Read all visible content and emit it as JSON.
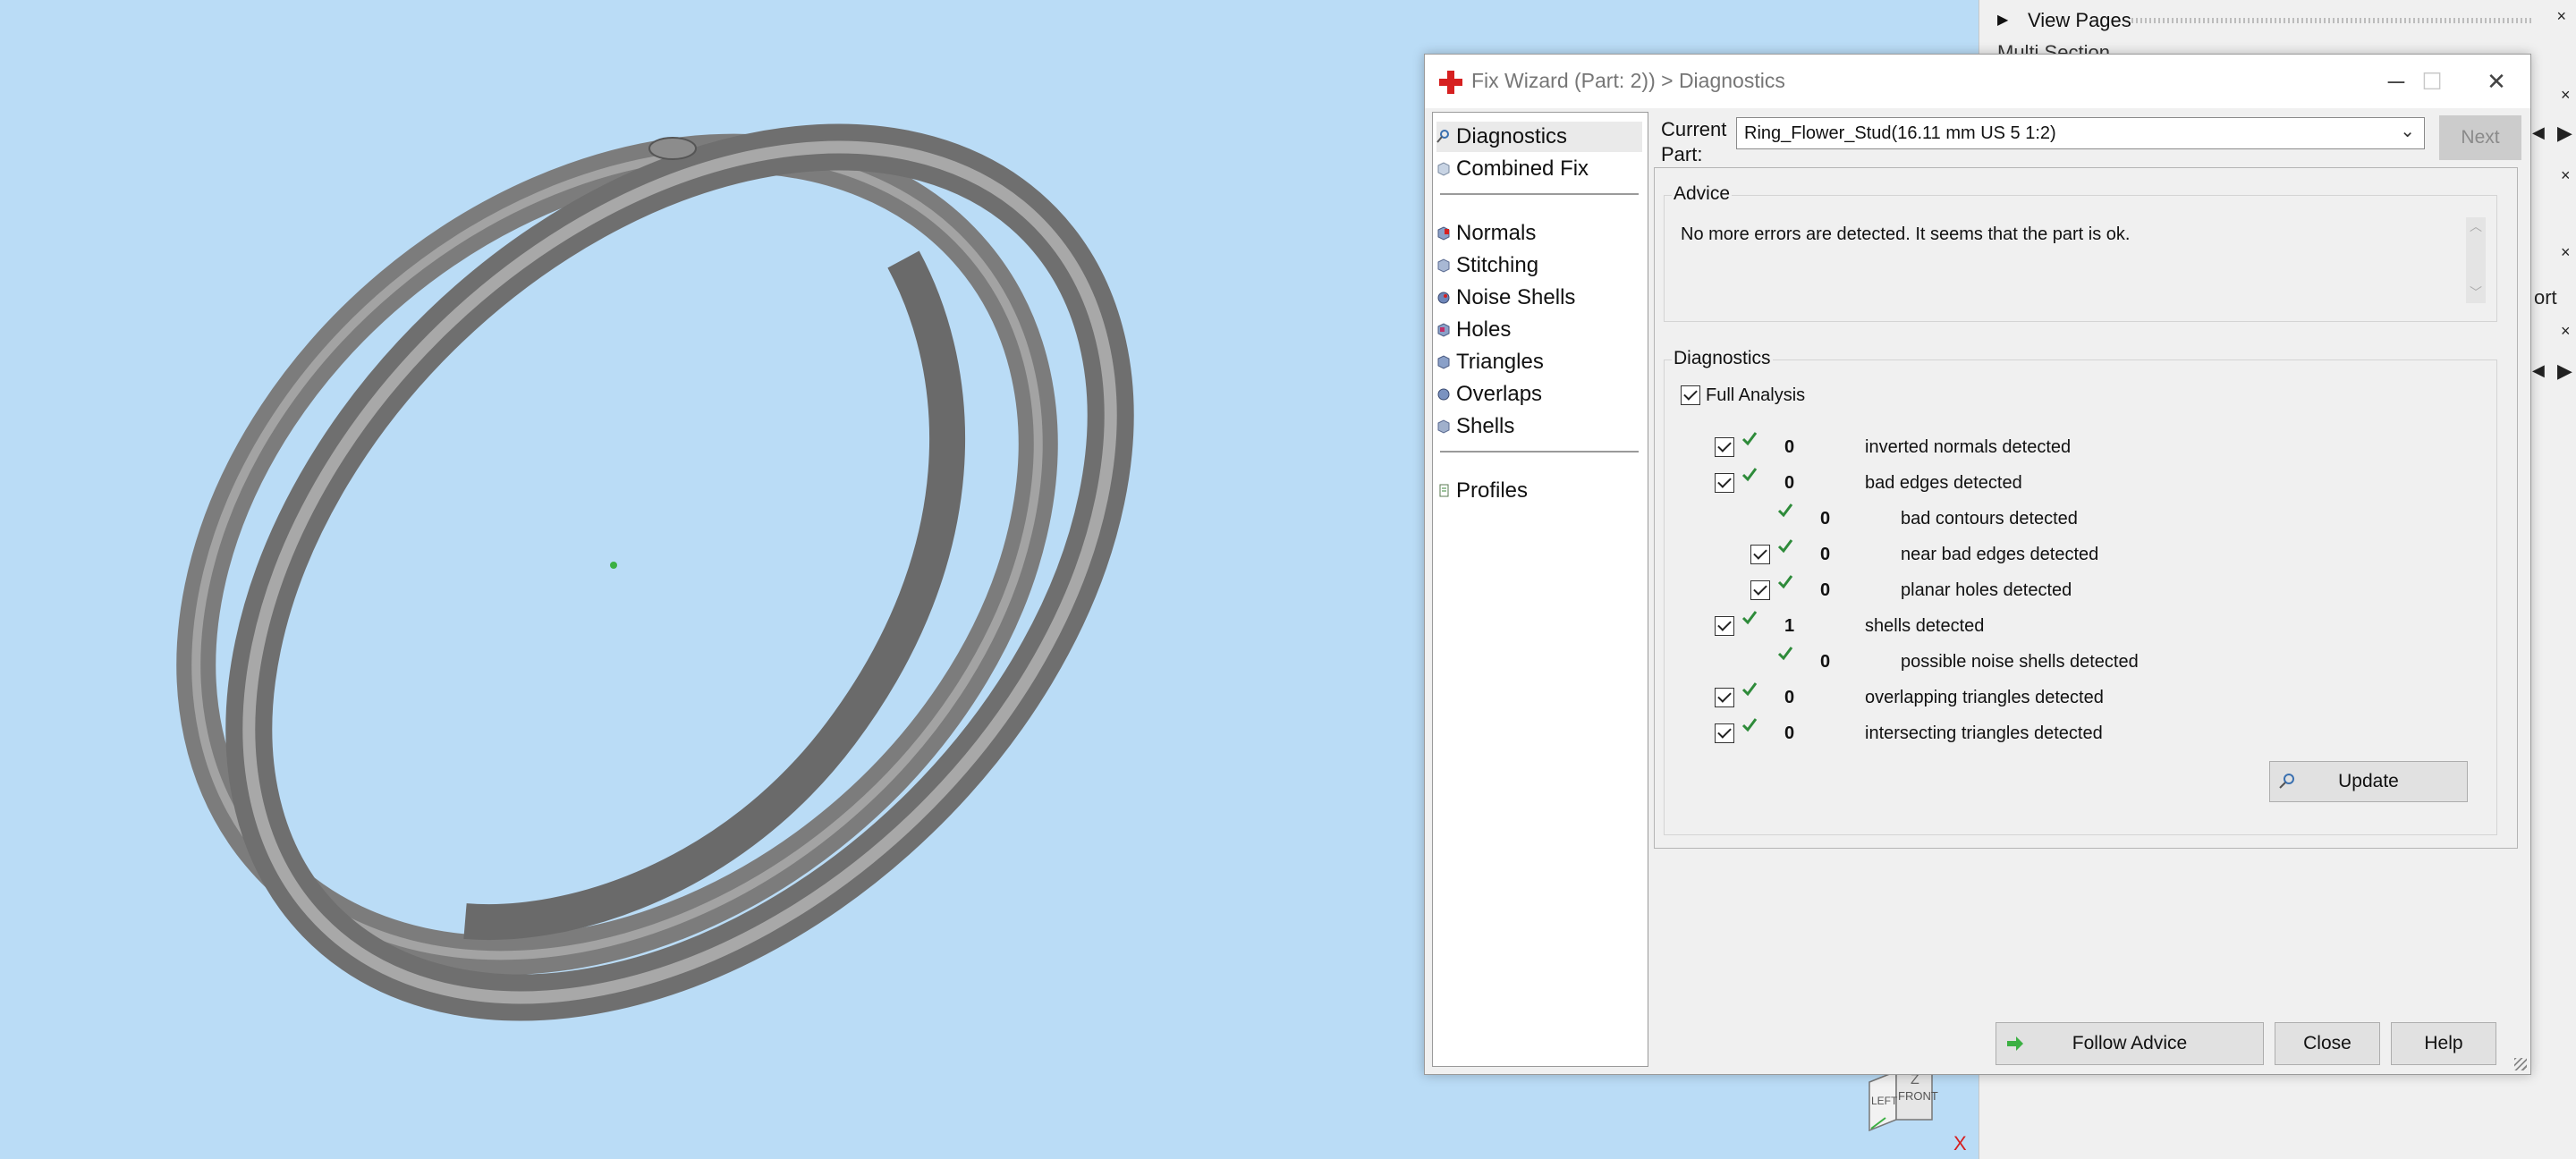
{
  "side_panel": {
    "row1_label": "View Pages",
    "row2_label": "Multi Section",
    "row3_label": "ort"
  },
  "dialog": {
    "title": "Fix Wizard (Part: 2)) > Diagnostics",
    "nav": {
      "items_top": [
        "Diagnostics",
        "Combined Fix"
      ],
      "items_mid": [
        "Normals",
        "Stitching",
        "Noise Shells",
        "Holes",
        "Triangles",
        "Overlaps",
        "Shells"
      ],
      "items_bottom": [
        "Profiles"
      ]
    },
    "current_part_label": "Current Part:",
    "current_part_value": "Ring_Flower_Stud(16.11 mm US 5 1:2)",
    "next_label": "Next",
    "advice_title": "Advice",
    "advice_text": "No more errors are detected. It seems that the part is ok.",
    "diagnostics_title": "Diagnostics",
    "full_analysis_label": "Full Analysis",
    "rows": [
      {
        "count": "0",
        "text": "inverted normals detected"
      },
      {
        "count": "0",
        "text": "bad edges detected"
      },
      {
        "count": "0",
        "text": "bad contours detected"
      },
      {
        "count": "0",
        "text": "near bad edges detected"
      },
      {
        "count": "0",
        "text": "planar holes detected"
      },
      {
        "count": "1",
        "text": "shells detected"
      },
      {
        "count": "0",
        "text": "possible noise shells detected"
      },
      {
        "count": "0",
        "text": "overlapping triangles detected"
      },
      {
        "count": "0",
        "text": "intersecting triangles detected"
      }
    ],
    "update_label": "Update",
    "follow_advice_label": "Follow Advice",
    "close_label": "Close",
    "help_label": "Help"
  },
  "viewcube": {
    "left_label": "LEFT",
    "front_label": "FRONT",
    "z_label": "Z",
    "x_label": "X"
  },
  "colors": {
    "viewport_bg": "#badcf6",
    "check_green": "#2e8b3a",
    "accent_red": "#d62020"
  }
}
